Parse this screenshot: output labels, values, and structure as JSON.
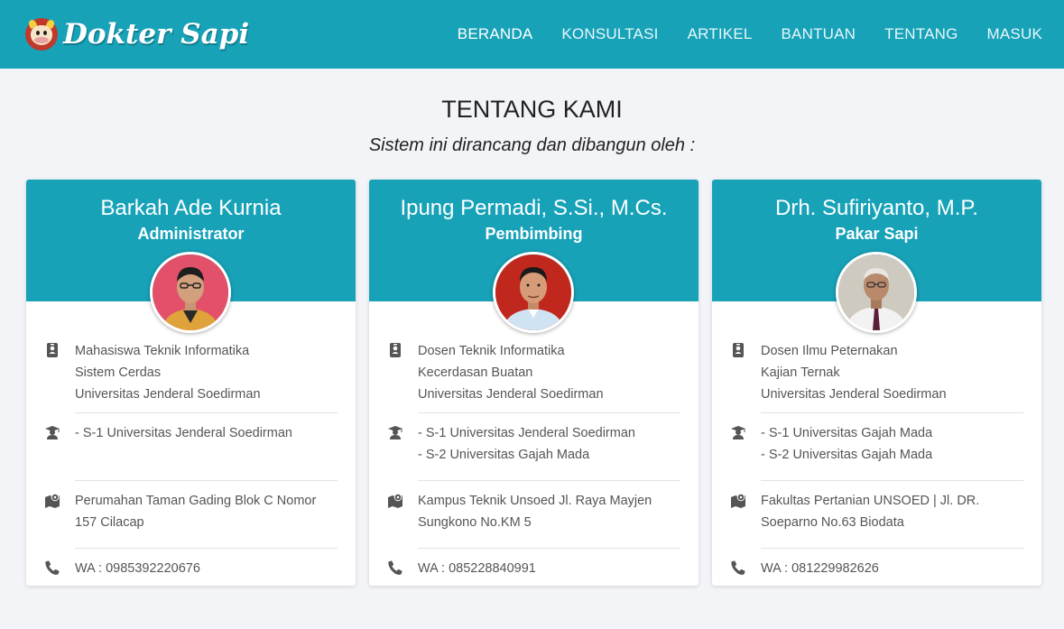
{
  "navbar": {
    "brand": "Dokter Sapi",
    "items": [
      {
        "label": "BERANDA",
        "active": true
      },
      {
        "label": "KONSULTASI"
      },
      {
        "label": "ARTIKEL"
      },
      {
        "label": "BANTUAN"
      },
      {
        "label": "TENTANG"
      },
      {
        "label": "MASUK"
      }
    ]
  },
  "page": {
    "title": "TENTANG KAMI",
    "subtitle": "Sistem ini dirancang dan dibangun oleh :"
  },
  "colors": {
    "primary": "#17a2b8",
    "background": "#f3f4f8",
    "icon": "#555555"
  },
  "cards": [
    {
      "name": "Barkah Ade Kurnia",
      "role": "Administrator",
      "job": [
        "Mahasiswa Teknik Informatika",
        "Sistem Cerdas",
        "Universitas Jenderal Soedirman"
      ],
      "education": [
        "- S-1 Universitas Jenderal Soedirman"
      ],
      "address": [
        "Perumahan Taman Gading Blok C Nomor",
        "157 Cilacap"
      ],
      "phone": "WA : 0985392220676"
    },
    {
      "name": "Ipung Permadi, S.Si., M.Cs.",
      "role": "Pembimbing",
      "job": [
        "Dosen Teknik Informatika",
        "Kecerdasan Buatan",
        "Universitas Jenderal Soedirman"
      ],
      "education": [
        "- S-1 Universitas Jenderal Soedirman",
        "- S-2 Universitas Gajah Mada"
      ],
      "address": [
        "Kampus Teknik Unsoed Jl. Raya Mayjen",
        "Sungkono No.KM 5"
      ],
      "phone": "WA : 085228840991"
    },
    {
      "name": "Drh. Sufiriyanto, M.P.",
      "role": "Pakar Sapi",
      "job": [
        "Dosen Ilmu Peternakan",
        "Kajian Ternak",
        "Universitas Jenderal Soedirman"
      ],
      "education": [
        "- S-1 Universitas Gajah Mada",
        "- S-2 Universitas Gajah Mada"
      ],
      "address": [
        "Fakultas Pertanian UNSOED | Jl. DR.",
        "Soeparno No.63 Biodata"
      ],
      "phone": "WA : 081229982626"
    }
  ]
}
